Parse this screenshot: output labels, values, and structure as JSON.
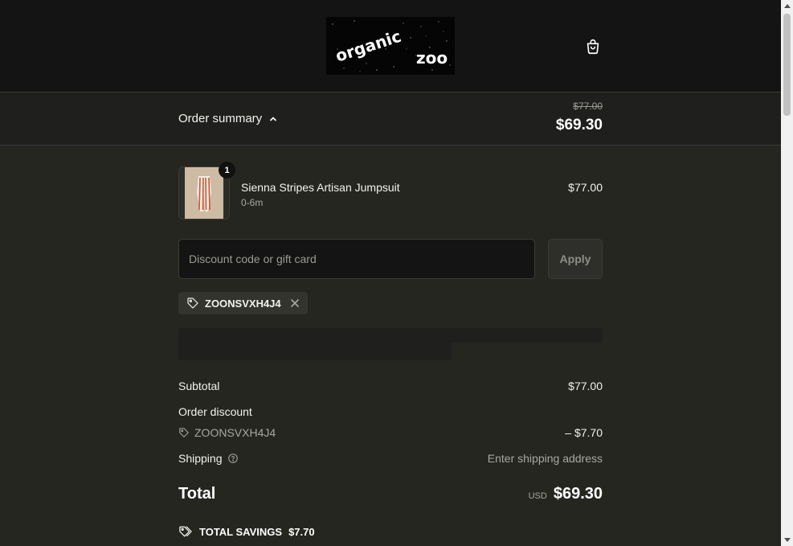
{
  "header": {
    "logo": {
      "line1": "organic",
      "line2": "zoo"
    },
    "cart_icon": "shopping-bag-icon"
  },
  "summary_bar": {
    "toggle_label": "Order summary",
    "toggle_icon": "chevron-up-icon",
    "original_total": "$77.00",
    "discounted_total": "$69.30"
  },
  "line_item": {
    "quantity": "1",
    "name": "Sienna Stripes Artisan Jumpsuit",
    "variant": "0-6m",
    "price": "$77.00"
  },
  "discount": {
    "placeholder": "Discount code or gift card",
    "value": "",
    "apply_label": "Apply",
    "applied_code": "ZOONSVXH4J4"
  },
  "totals": {
    "subtotal_label": "Subtotal",
    "subtotal_value": "$77.00",
    "order_discount_label": "Order discount",
    "discount_code": "ZOONSVXH4J4",
    "discount_amount": "– $7.70",
    "shipping_label": "Shipping",
    "shipping_value": "Enter shipping address",
    "total_label": "Total",
    "currency": "USD",
    "total_value": "$69.30"
  },
  "savings": {
    "label": "TOTAL SAVINGS",
    "amount": "$7.70"
  },
  "colors": {
    "background": "#262620",
    "header": "#141414",
    "summary_bar": "#1f1f1d",
    "text": "#f2f2ee",
    "muted": "#a8a8a2"
  }
}
